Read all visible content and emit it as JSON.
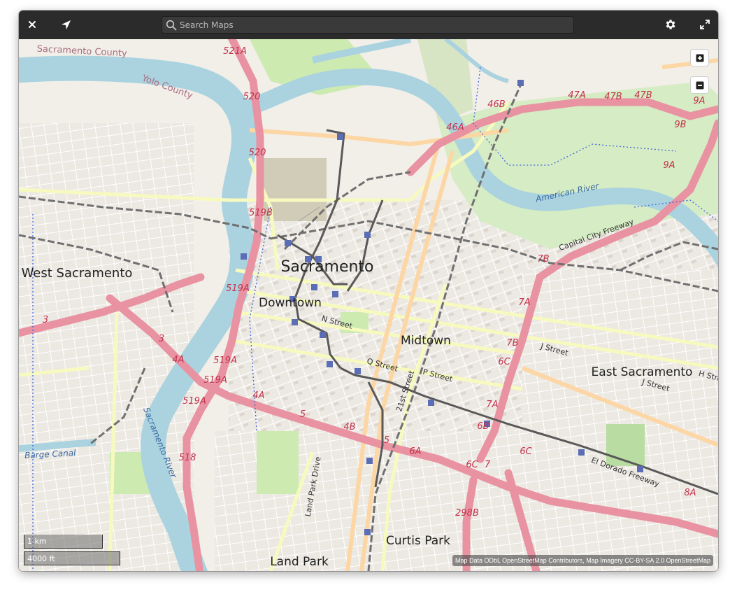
{
  "header": {
    "close_icon": "close-icon",
    "locate_icon": "location-arrow-icon",
    "search_placeholder": "Search Maps",
    "settings_icon": "gear-icon",
    "fullscreen_icon": "fullscreen-icon"
  },
  "colors": {
    "header": "#2b2b2b",
    "land": "#f2efe9",
    "water": "#aad3df",
    "park": "#cdebb0",
    "motorway": "#e892a2",
    "primary": "#fcd6a4",
    "secondary": "#f7fabf",
    "rail": "#707070",
    "light_rail": "#595959",
    "station": "#5b6db5"
  },
  "map": {
    "places": {
      "sacramento": "Sacramento",
      "downtown": "Downtown",
      "midtown": "Midtown",
      "east_sacramento": "East Sacramento",
      "west_sacramento": "West Sacramento",
      "curtis_park": "Curtis Park",
      "land_park": "Land Park"
    },
    "regions": {
      "sacramento_county": "Sacramento County",
      "yolo_county": "Yolo County"
    },
    "water": {
      "american_river": "American River",
      "sacramento_river": "Sacramento River",
      "barge_canal": "Barge Canal"
    },
    "streets": {
      "n_street": "N Street",
      "q_street": "Q Street",
      "p_street": "P Street",
      "j_street_mid": "J Street",
      "j_street_east": "J Street",
      "h_street": "H Stre",
      "21st_street": "21st Street",
      "land_park_drive": "Land Park Drive",
      "capital_city_freeway": "Capital City Freeway",
      "el_dorado_freeway": "El Dorado Freeway"
    },
    "exits": [
      "521A",
      "520",
      "520",
      "519B",
      "519A",
      "519A",
      "519A",
      "519A",
      "518",
      "4A",
      "4A",
      "3",
      "3",
      "5",
      "5",
      "4B",
      "6A",
      "6C",
      "7",
      "6B",
      "7A",
      "6C",
      "6C",
      "7B",
      "7A",
      "7B",
      "298B",
      "46B",
      "46A",
      "47A",
      "47B",
      "47B",
      "9A",
      "9B",
      "9A",
      "8A"
    ]
  },
  "controls": {
    "zoom_in_icon": "plus-icon",
    "zoom_out_icon": "minus-icon"
  },
  "scale": {
    "metric": "1 km",
    "imperial": "4000 ft"
  },
  "attribution": "Map Data ODbL OpenStreetMap Contributors, Map Imagery CC-BY-SA 2.0 OpenStreetMap"
}
